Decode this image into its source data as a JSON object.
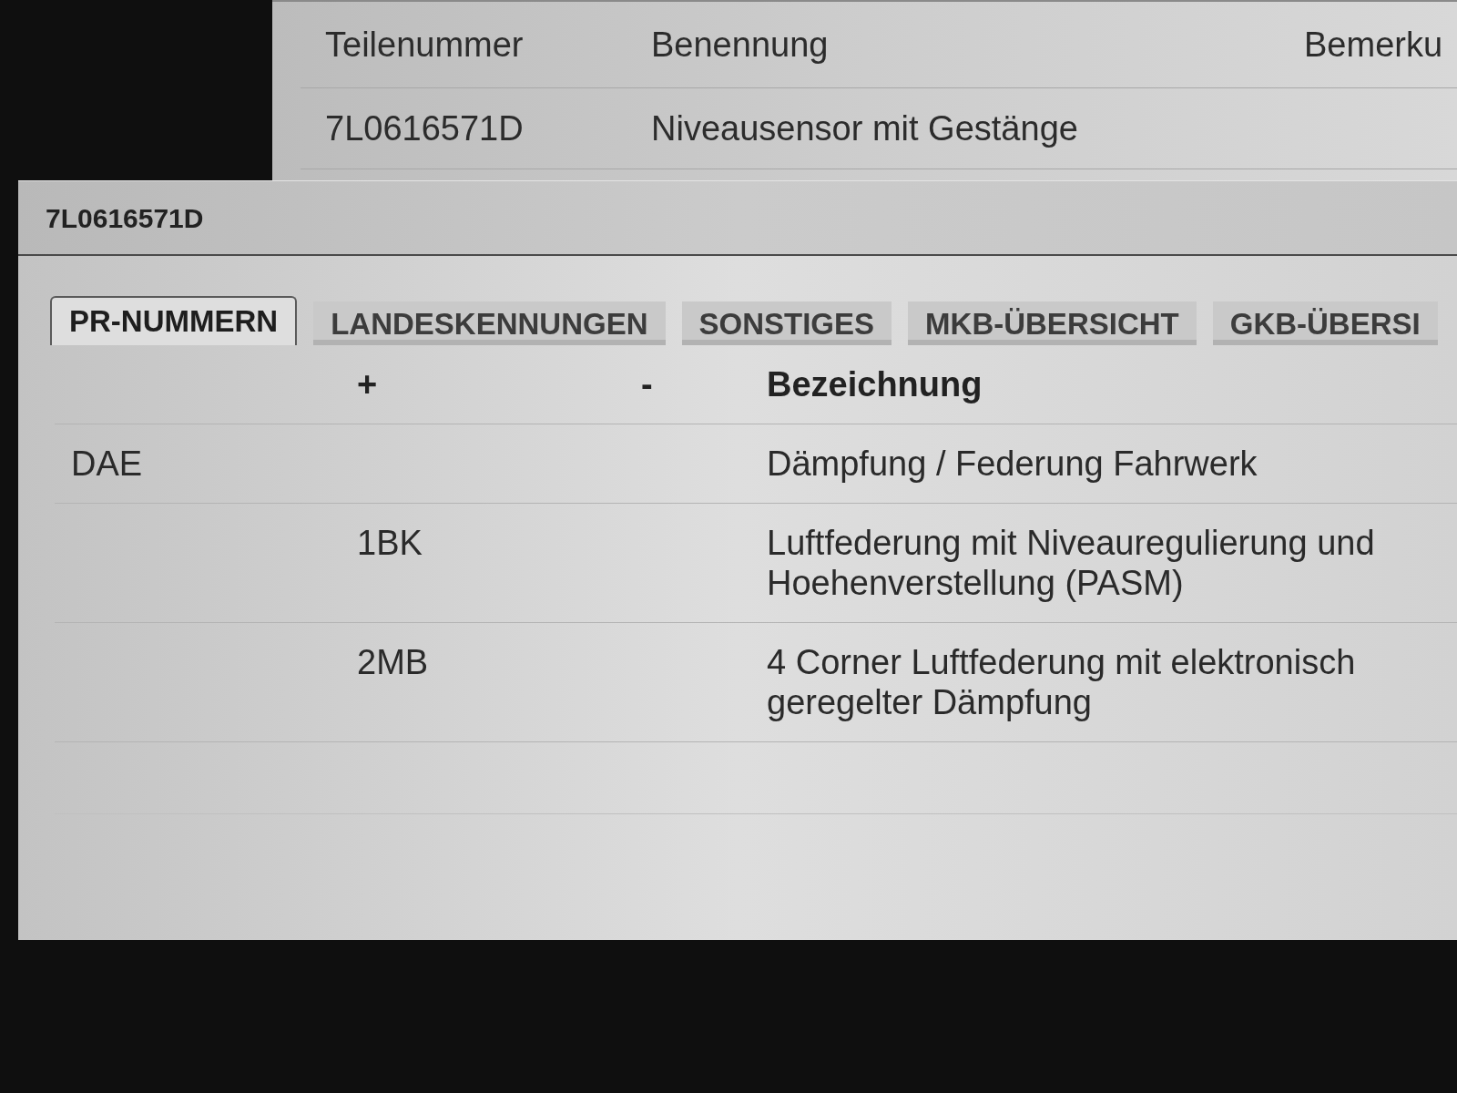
{
  "background_window": {
    "table": {
      "columns": [
        "Teilenummer",
        "Benennung",
        "Bemerku"
      ],
      "rows": [
        [
          "7L0616571D",
          "Niveausensor mit Gestänge"
        ]
      ]
    }
  },
  "dialog": {
    "title": "7L0616571D",
    "tabs": [
      {
        "label": "PR-NUMMERN",
        "selected": true
      },
      {
        "label": "LANDESKENNUNGEN",
        "selected": false
      },
      {
        "label": "SONSTIGES",
        "selected": false
      },
      {
        "label": "MKB-ÜBERSICHT",
        "selected": false
      },
      {
        "label": "GKB-ÜBERSI",
        "selected": false
      }
    ],
    "table": {
      "columns": {
        "plus": "+",
        "minus": "-",
        "bezeichnung": "Bezeichnung"
      },
      "rows": [
        {
          "column_1": "DAE",
          "bezeichnung": "Dämpfung / Federung Fahrwerk"
        },
        {
          "plus": "1BK",
          "bezeichnung": "Luftfederung mit Niveauregulierung und Hoehenverstellung (PASM)"
        },
        {
          "plus": "2MB",
          "bezeichnung": "4 Corner Luftfederung mit elektronisch geregelter Dämpfung"
        }
      ]
    }
  }
}
